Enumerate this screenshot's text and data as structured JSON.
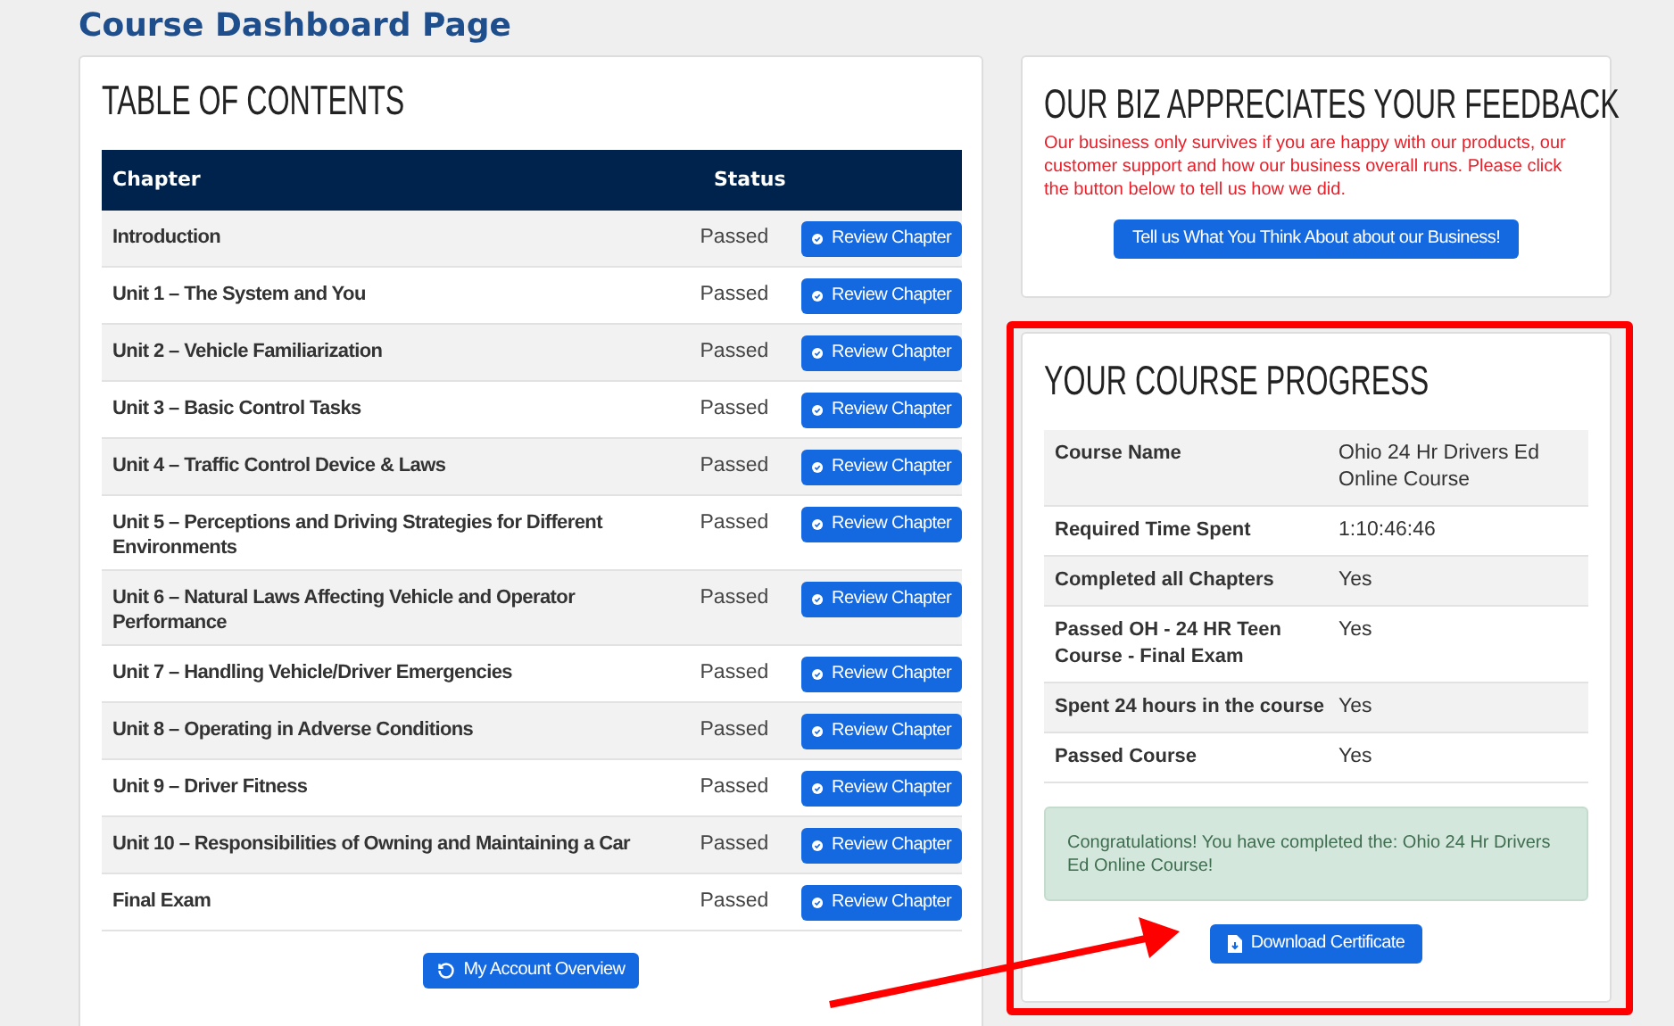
{
  "page_title": "Course Dashboard Page",
  "toc": {
    "heading": "TABLE OF CONTENTS",
    "columns": [
      "Chapter",
      "Status"
    ],
    "rows": [
      {
        "chapter": "Introduction",
        "status": "Passed",
        "action": "Review Chapter"
      },
      {
        "chapter": "Unit 1 – The System and You",
        "status": "Passed",
        "action": "Review Chapter"
      },
      {
        "chapter": "Unit 2 – Vehicle Familiarization",
        "status": "Passed",
        "action": "Review Chapter"
      },
      {
        "chapter": "Unit 3 – Basic Control Tasks",
        "status": "Passed",
        "action": "Review Chapter"
      },
      {
        "chapter": "Unit 4 – Traffic Control Device & Laws",
        "status": "Passed",
        "action": "Review Chapter"
      },
      {
        "chapter": "Unit 5 – Perceptions and Driving Strategies for Different Environments",
        "status": "Passed",
        "action": "Review Chapter"
      },
      {
        "chapter": "Unit 6 – Natural Laws Affecting Vehicle and Operator Performance",
        "status": "Passed",
        "action": "Review Chapter"
      },
      {
        "chapter": "Unit 7 – Handling Vehicle/Driver Emergencies",
        "status": "Passed",
        "action": "Review Chapter"
      },
      {
        "chapter": "Unit 8 – Operating in Adverse Conditions",
        "status": "Passed",
        "action": "Review Chapter"
      },
      {
        "chapter": "Unit 9 – Driver Fitness",
        "status": "Passed",
        "action": "Review Chapter"
      },
      {
        "chapter": "Unit 10 – Responsibilities of Owning and Maintaining a Car",
        "status": "Passed",
        "action": "Review Chapter"
      },
      {
        "chapter": "Final Exam",
        "status": "Passed",
        "action": "Review Chapter"
      }
    ],
    "footer_button": "My Account Overview"
  },
  "feedback": {
    "heading": "OUR BIZ APPRECIATES YOUR FEEDBACK",
    "text": "Our business only survives if you are happy with our products, our customer support and how our business overall runs. Please click the button below to tell us how we did.",
    "button": "Tell us What You Think About about our Business!"
  },
  "progress": {
    "heading": "YOUR COURSE PROGRESS",
    "highlighted": true,
    "rows": [
      {
        "label": "Course Name",
        "value": "Ohio 24 Hr Drivers Ed Online Course"
      },
      {
        "label": "Required Time Spent",
        "value": "1:10:46:46"
      },
      {
        "label": "Completed all Chapters",
        "value": "Yes"
      },
      {
        "label": "Passed OH - 24 HR Teen Course - Final Exam",
        "value": "Yes"
      },
      {
        "label": "Spent 24 hours in the course",
        "value": "Yes"
      },
      {
        "label": "Passed Course",
        "value": "Yes"
      }
    ],
    "alert": "Congratulations! You have completed the: Ohio 24 Hr Drivers Ed Online Course!",
    "button": "Download Certificate"
  }
}
